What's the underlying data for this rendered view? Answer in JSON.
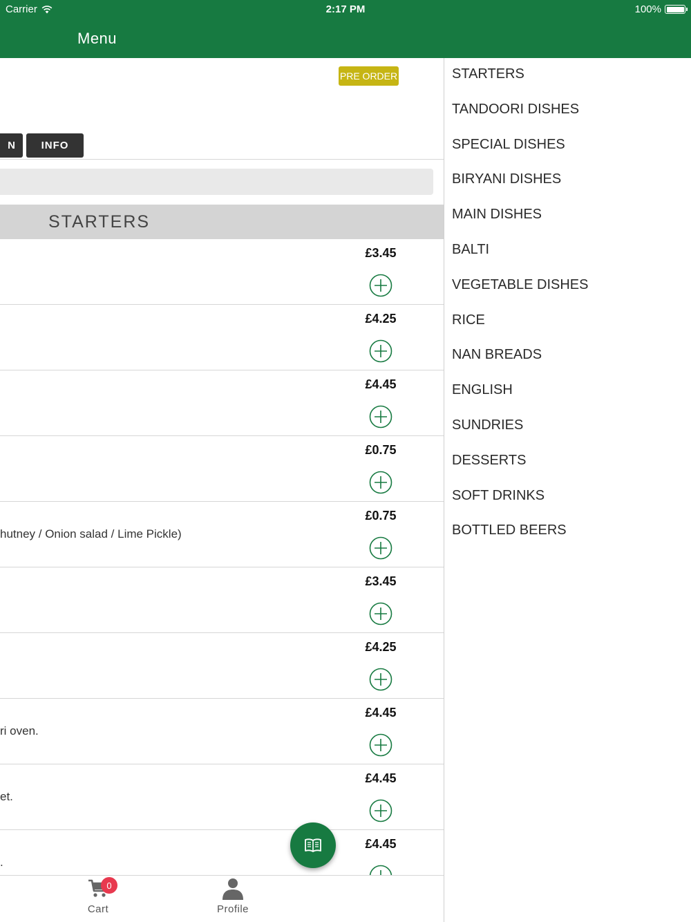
{
  "status_bar": {
    "carrier": "Carrier",
    "time": "2:17 PM",
    "battery": "100%",
    "icons": [
      "wifi-icon",
      "battery-icon"
    ]
  },
  "header": {
    "title": "Menu"
  },
  "main": {
    "pre_order_badge": "PRE ORDER",
    "tabs": [
      {
        "label": "N"
      },
      {
        "label": "INFO"
      }
    ],
    "section_title": "STARTERS",
    "items": [
      {
        "price": "£3.45",
        "description": ""
      },
      {
        "price": "£4.25",
        "description": ""
      },
      {
        "price": "£4.45",
        "description": ""
      },
      {
        "price": "£0.75",
        "description": ""
      },
      {
        "price": "£0.75",
        "description": "hutney / Onion salad / Lime Pickle)"
      },
      {
        "price": "£3.45",
        "description": ""
      },
      {
        "price": "£4.25",
        "description": ""
      },
      {
        "price": "£4.45",
        "description": "ri oven."
      },
      {
        "price": "£4.45",
        "description": "et."
      },
      {
        "price": "£4.45",
        "description": "."
      }
    ]
  },
  "tab_bar": {
    "cart_label": "Cart",
    "cart_count": "0",
    "profile_label": "Profile"
  },
  "drawer": {
    "categories": [
      "STARTERS",
      "TANDOORI DISHES",
      "SPECIAL DISHES",
      "BIRYANI DISHES",
      "MAIN DISHES",
      "BALTI",
      "VEGETABLE DISHES",
      "RICE",
      "NAN BREADS",
      "ENGLISH",
      "SUNDRIES",
      "DESSERTS",
      "SOFT DRINKS",
      "BOTTLED BEERS"
    ]
  },
  "colors": {
    "brand_green": "#177a41",
    "pre_order_yellow": "#c6b514",
    "badge_red": "#e8394f",
    "tab_dark": "#333333"
  }
}
